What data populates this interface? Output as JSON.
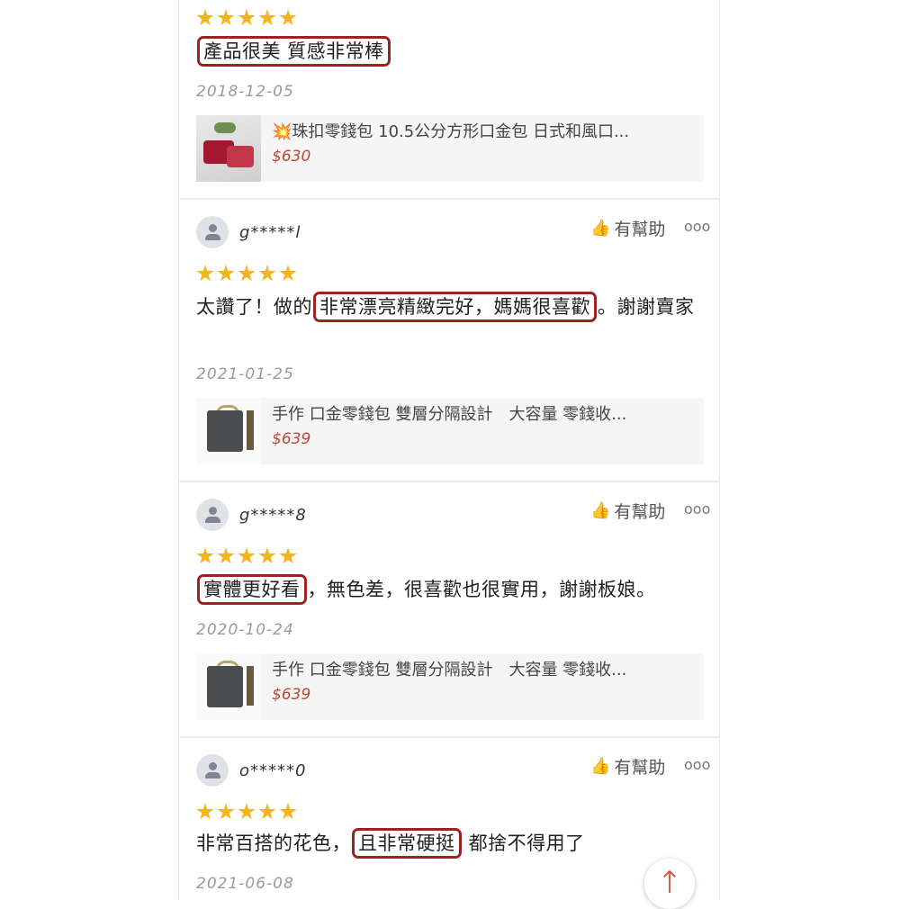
{
  "reviews": [
    {
      "user": "",
      "rating": 5,
      "text_parts": [
        {
          "t": "產品很美 質感非常棒",
          "hl": true
        }
      ],
      "date": "2018-12-05",
      "product": {
        "title_emoji": "💥",
        "title": "珠扣零錢包 10.5公分方形口金包 日式和風口...",
        "price": "$630",
        "icon": "red-floral-purse-thumbnail"
      }
    },
    {
      "user": "g*****l",
      "helpful_label": "有幫助",
      "rating": 5,
      "text_parts": [
        {
          "t": "太讚了！做的",
          "hl": false
        },
        {
          "t": "非常漂亮精緻完好，媽媽很喜歡",
          "hl": true
        },
        {
          "t": "。謝謝賣家",
          "hl": false
        }
      ],
      "date": "2021-01-25",
      "product": {
        "title": "手作 口金零錢包 雙層分隔設計　大容量 零錢收...",
        "price": "$639",
        "icon": "dark-floral-purse-thumbnail"
      }
    },
    {
      "user": "g*****8",
      "helpful_label": "有幫助",
      "rating": 5,
      "text_parts": [
        {
          "t": "實體更好看",
          "hl": true
        },
        {
          "t": "，無色差，很喜歡也很實用，謝謝板娘。",
          "hl": false
        }
      ],
      "date": "2020-10-24",
      "product": {
        "title": "手作 口金零錢包 雙層分隔設計　大容量 零錢收...",
        "price": "$639",
        "icon": "dark-floral-purse-thumbnail"
      }
    },
    {
      "user": "o*****0",
      "helpful_label": "有幫助",
      "rating": 5,
      "text_parts": [
        {
          "t": "非常百搭的花色，",
          "hl": false
        },
        {
          "t": "且非常硬挺",
          "hl": true
        },
        {
          "t": " 都捨不得用了",
          "hl": false
        }
      ],
      "date": "2021-06-08"
    }
  ],
  "more_label": "ooo",
  "back_to_top": "↑",
  "colors": {
    "star": "#f3b51b",
    "highlight_border": "#9d2322",
    "price": "#c0463a"
  }
}
